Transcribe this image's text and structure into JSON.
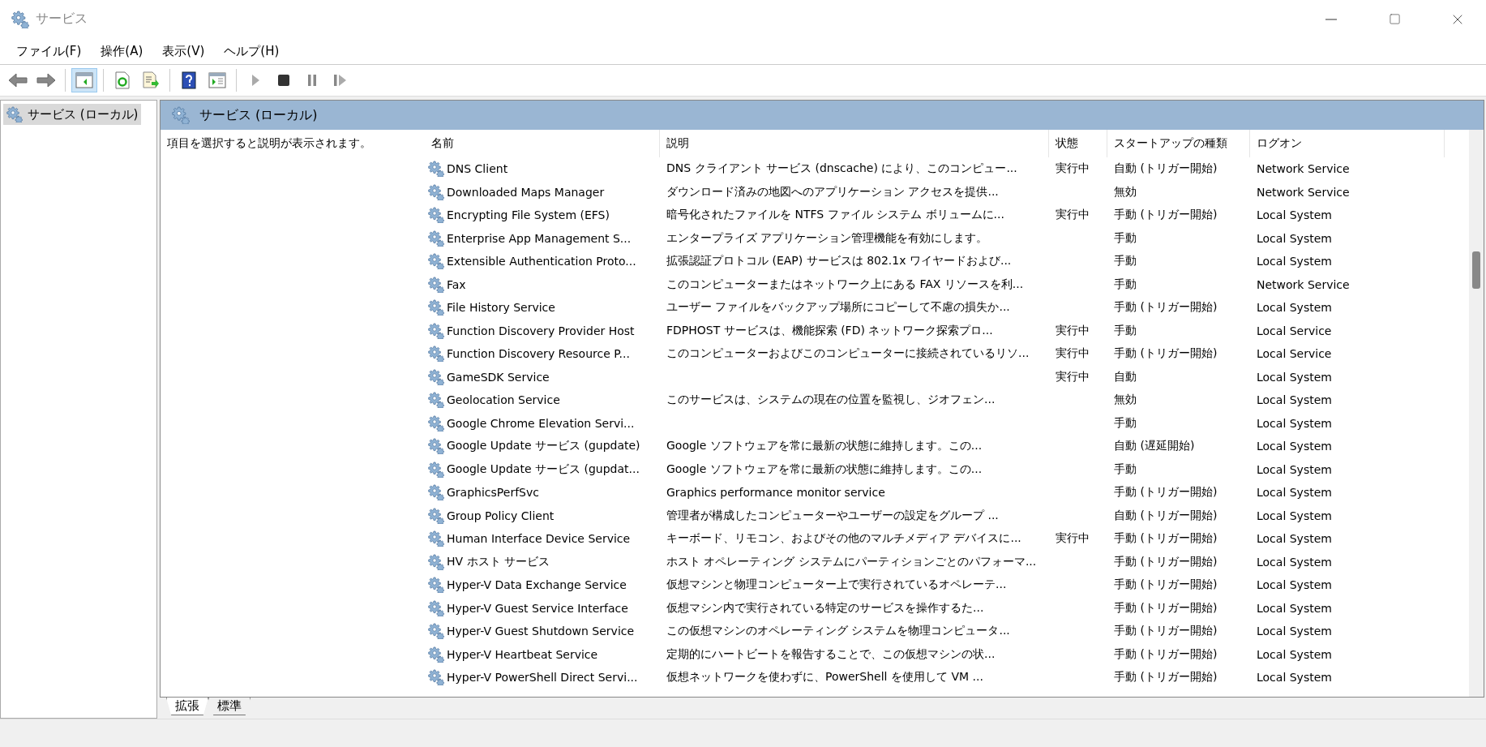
{
  "window": {
    "title": "サービス"
  },
  "menu": [
    "ファイル(F)",
    "操作(A)",
    "表示(V)",
    "ヘルプ(H)"
  ],
  "toolbar": [
    {
      "kind": "back",
      "disabled": false
    },
    {
      "kind": "forward",
      "disabled": false
    },
    {
      "kind": "sep"
    },
    {
      "kind": "pane",
      "selected": true
    },
    {
      "kind": "sep"
    },
    {
      "kind": "refresh"
    },
    {
      "kind": "export"
    },
    {
      "kind": "sep"
    },
    {
      "kind": "help"
    },
    {
      "kind": "view"
    },
    {
      "kind": "sep"
    },
    {
      "kind": "play",
      "disabled": true
    },
    {
      "kind": "stop",
      "disabled": false
    },
    {
      "kind": "pause",
      "disabled": true
    },
    {
      "kind": "resume",
      "disabled": true
    }
  ],
  "tree": [
    {
      "label": "サービス (ローカル)",
      "selected": true
    }
  ],
  "panel": {
    "title": "サービス (ローカル)",
    "hint": "項目を選択すると説明が表示されます。"
  },
  "table": {
    "columns": [
      "名前",
      "説明",
      "状態",
      "スタートアップの種類",
      "ログオン"
    ],
    "rows": [
      {
        "name": "DNS Client",
        "description": "DNS クライアント サービス (dnscache) により、このコンピュー...",
        "status": "実行中",
        "startup": "自動 (トリガー開始)",
        "logon": "Network Service"
      },
      {
        "name": "Downloaded Maps Manager",
        "description": "ダウンロード済みの地図へのアプリケーション アクセスを提供...",
        "status": "",
        "startup": "無効",
        "logon": "Network Service"
      },
      {
        "name": "Encrypting File System (EFS)",
        "description": "暗号化されたファイルを NTFS ファイル システム ボリュームに...",
        "status": "実行中",
        "startup": "手動 (トリガー開始)",
        "logon": "Local System"
      },
      {
        "name": "Enterprise App Management S...",
        "description": "エンタープライズ アプリケーション管理機能を有効にします。",
        "status": "",
        "startup": "手動",
        "logon": "Local System"
      },
      {
        "name": "Extensible Authentication Proto...",
        "description": "拡張認証プロトコル (EAP) サービスは 802.1x ワイヤードおよび...",
        "status": "",
        "startup": "手動",
        "logon": "Local System"
      },
      {
        "name": "Fax",
        "description": "このコンピューターまたはネットワーク上にある FAX リソースを利...",
        "status": "",
        "startup": "手動",
        "logon": "Network Service"
      },
      {
        "name": "File History Service",
        "description": "ユーザー ファイルをバックアップ場所にコピーして不慮の損失か...",
        "status": "",
        "startup": "手動 (トリガー開始)",
        "logon": "Local System"
      },
      {
        "name": "Function Discovery Provider Host",
        "description": "FDPHOST サービスは、機能探索 (FD) ネットワーク探索プロ...",
        "status": "実行中",
        "startup": "手動",
        "logon": "Local Service"
      },
      {
        "name": "Function Discovery Resource P...",
        "description": "このコンピューターおよびこのコンピューターに接続されているリソ...",
        "status": "実行中",
        "startup": "手動 (トリガー開始)",
        "logon": "Local Service"
      },
      {
        "name": "GameSDK Service",
        "description": "",
        "status": "実行中",
        "startup": "自動",
        "logon": "Local System"
      },
      {
        "name": "Geolocation Service",
        "description": "このサービスは、システムの現在の位置を監視し、ジオフェン...",
        "status": "",
        "startup": "無効",
        "logon": "Local System"
      },
      {
        "name": "Google Chrome Elevation Servi...",
        "description": "",
        "status": "",
        "startup": "手動",
        "logon": "Local System"
      },
      {
        "name": "Google Update サービス (gupdate)",
        "description": "Google ソフトウェアを常に最新の状態に維持します。この...",
        "status": "",
        "startup": "自動 (遅延開始)",
        "logon": "Local System"
      },
      {
        "name": "Google Update サービス (gupdat...",
        "description": "Google ソフトウェアを常に最新の状態に維持します。この...",
        "status": "",
        "startup": "手動",
        "logon": "Local System"
      },
      {
        "name": "GraphicsPerfSvc",
        "description": "Graphics performance monitor service",
        "status": "",
        "startup": "手動 (トリガー開始)",
        "logon": "Local System"
      },
      {
        "name": "Group Policy Client",
        "description": "管理者が構成したコンピューターやユーザーの設定をグループ ...",
        "status": "",
        "startup": "自動 (トリガー開始)",
        "logon": "Local System"
      },
      {
        "name": "Human Interface Device Service",
        "description": "キーボード、リモコン、およびその他のマルチメディア デバイスに...",
        "status": "実行中",
        "startup": "手動 (トリガー開始)",
        "logon": "Local System"
      },
      {
        "name": "HV ホスト サービス",
        "description": "ホスト オペレーティング システムにパーティションごとのパフォーマ...",
        "status": "",
        "startup": "手動 (トリガー開始)",
        "logon": "Local System"
      },
      {
        "name": "Hyper-V Data Exchange Service",
        "description": "仮想マシンと物理コンピューター上で実行されているオペレーテ...",
        "status": "",
        "startup": "手動 (トリガー開始)",
        "logon": "Local System"
      },
      {
        "name": "Hyper-V Guest Service Interface",
        "description": "仮想マシン内で実行されている特定のサービスを操作するた...",
        "status": "",
        "startup": "手動 (トリガー開始)",
        "logon": "Local System"
      },
      {
        "name": "Hyper-V Guest Shutdown Service",
        "description": "この仮想マシンのオペレーティング システムを物理コンピュータ...",
        "status": "",
        "startup": "手動 (トリガー開始)",
        "logon": "Local System"
      },
      {
        "name": "Hyper-V Heartbeat Service",
        "description": "定期的にハートビートを報告することで、この仮想マシンの状...",
        "status": "",
        "startup": "手動 (トリガー開始)",
        "logon": "Local System"
      },
      {
        "name": "Hyper-V PowerShell Direct Servi...",
        "description": "仮想ネットワークを使わずに、PowerShell を使用して VM ...",
        "status": "",
        "startup": "手動 (トリガー開始)",
        "logon": "Local System"
      }
    ]
  },
  "bottom_tabs": [
    {
      "label": "拡張",
      "selected": true
    },
    {
      "label": "標準",
      "selected": false
    }
  ]
}
